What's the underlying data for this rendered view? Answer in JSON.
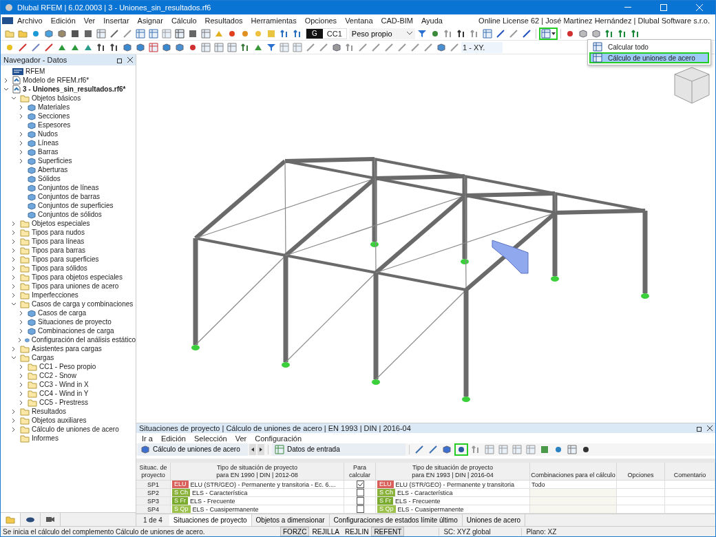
{
  "window": {
    "title": "Dlubal RFEM | 6.02.0003 | 3 - Uniones_sin_resultados.rf6"
  },
  "menu": [
    "Archivo",
    "Edición",
    "Ver",
    "Insertar",
    "Asignar",
    "Cálculo",
    "Resultados",
    "Herramientas",
    "Opciones",
    "Ventana",
    "CAD-BIM",
    "Ayuda"
  ],
  "license": "Online License 62 | José Martinez Hernández | Dlubal Software s.r.o.",
  "toolbar": {
    "load_case_prefix": "G",
    "load_case": "CC1",
    "load_case_name": "Peso propio",
    "view_field": "1 - XY.",
    "calculate_highlighted": true
  },
  "calc_menu": [
    {
      "label": "Calcular todo",
      "selected": false,
      "highlighted": false
    },
    {
      "label": "Cálculo de uniones de acero",
      "selected": true,
      "highlighted": true
    }
  ],
  "navigator": {
    "title": "Navegador - Datos",
    "tree": [
      {
        "label": "RFEM",
        "kind": "root"
      },
      {
        "label": "Modelo de RFEM.rf6*",
        "kind": "model",
        "expanded": false
      },
      {
        "label": "3 - Uniones_sin_resultados.rf6*",
        "kind": "model",
        "bold": true,
        "expanded": true,
        "children": [
          {
            "label": "Objetos básicos",
            "kind": "folder",
            "expanded": true,
            "children": [
              {
                "label": "Materiales",
                "kind": "object",
                "expanded": false
              },
              {
                "label": "Secciones",
                "kind": "object",
                "expanded": false
              },
              {
                "label": "Espesores",
                "kind": "object"
              },
              {
                "label": "Nudos",
                "kind": "object",
                "expanded": false
              },
              {
                "label": "Líneas",
                "kind": "object",
                "expanded": false
              },
              {
                "label": "Barras",
                "kind": "object",
                "expanded": false
              },
              {
                "label": "Superficies",
                "kind": "object",
                "expanded": false
              },
              {
                "label": "Aberturas",
                "kind": "object"
              },
              {
                "label": "Sólidos",
                "kind": "object"
              },
              {
                "label": "Conjuntos de líneas",
                "kind": "object"
              },
              {
                "label": "Conjuntos de barras",
                "kind": "object"
              },
              {
                "label": "Conjuntos de superficies",
                "kind": "object"
              },
              {
                "label": "Conjuntos de sólidos",
                "kind": "object"
              }
            ]
          },
          {
            "label": "Objetos especiales",
            "kind": "folder",
            "expanded": false
          },
          {
            "label": "Tipos para nudos",
            "kind": "folder",
            "expanded": false
          },
          {
            "label": "Tipos para líneas",
            "kind": "folder",
            "expanded": false
          },
          {
            "label": "Tipos para barras",
            "kind": "folder",
            "expanded": false
          },
          {
            "label": "Tipos para superficies",
            "kind": "folder",
            "expanded": false
          },
          {
            "label": "Tipos para sólidos",
            "kind": "folder",
            "expanded": false
          },
          {
            "label": "Tipos para objetos especiales",
            "kind": "folder",
            "expanded": false
          },
          {
            "label": "Tipos para uniones de acero",
            "kind": "folder",
            "expanded": false
          },
          {
            "label": "Imperfecciones",
            "kind": "folder",
            "expanded": false
          },
          {
            "label": "Casos de carga y combinaciones",
            "kind": "folder",
            "expanded": true,
            "children": [
              {
                "label": "Casos de carga",
                "kind": "object",
                "expanded": false
              },
              {
                "label": "Situaciones de proyecto",
                "kind": "object",
                "expanded": false
              },
              {
                "label": "Combinaciones de carga",
                "kind": "object",
                "expanded": false
              },
              {
                "label": "Configuración del análisis estático",
                "kind": "object",
                "expanded": false
              }
            ]
          },
          {
            "label": "Asistentes para cargas",
            "kind": "folder",
            "expanded": false
          },
          {
            "label": "Cargas",
            "kind": "folder",
            "expanded": true,
            "children": [
              {
                "label": "CC1 - Peso propio",
                "kind": "folder",
                "expanded": false
              },
              {
                "label": "CC2 - Snow",
                "kind": "folder",
                "expanded": false
              },
              {
                "label": "CC3 - Wind in X",
                "kind": "folder",
                "expanded": false
              },
              {
                "label": "CC4 - Wind in Y",
                "kind": "folder",
                "expanded": false
              },
              {
                "label": "CC5 - Prestress",
                "kind": "folder",
                "expanded": false
              }
            ]
          },
          {
            "label": "Resultados",
            "kind": "folder",
            "expanded": false
          },
          {
            "label": "Objetos auxiliares",
            "kind": "folder",
            "expanded": false
          },
          {
            "label": "Cálculo de uniones de acero",
            "kind": "folder",
            "expanded": false
          },
          {
            "label": "Informes",
            "kind": "folder"
          }
        ]
      }
    ],
    "tabs": [
      {
        "selected": true
      },
      {
        "selected": false
      },
      {
        "selected": false
      }
    ]
  },
  "panel": {
    "title": "Situaciones de proyecto | Cálculo de uniones de acero | EN 1993 | DIN | 2016-04",
    "menu": [
      "Ir a",
      "Edición",
      "Selección",
      "Ver",
      "Configuración"
    ],
    "module": "Cálculo de uniones de acero",
    "view": "Datos de entrada",
    "calculate_highlighted": true,
    "columns": [
      "Situac. de\nproyecto",
      "Tipo de situación de proyecto\npara EN 1990 | DIN | 2012-08",
      "Para\ncalcular",
      "Tipo de situación de proyecto\npara EN 1993 | DIN | 2016-04",
      "Combinaciones para el cálculo",
      "Opciones",
      "Comentario"
    ],
    "rows": [
      {
        "id": "SP1",
        "tag": "ELU",
        "color": "#d9605a",
        "type": "ELU (STR/GEO) - Permanente y transitoria - Ec. 6....",
        "checked": true,
        "tag2": "ELU",
        "type2": "ELU (STR/GEO) - Permanente y transitoria",
        "combos": "Todo"
      },
      {
        "id": "SP2",
        "tag": "S Ch",
        "color": "#8bb33c",
        "type": "ELS - Característica",
        "checked": false,
        "tag2": "S Ch",
        "type2": "ELS - Característica"
      },
      {
        "id": "SP3",
        "tag": "S Fr",
        "color": "#7aab2c",
        "type": "ELS - Frecuente",
        "checked": false,
        "tag2": "S Fr",
        "type2": "ELS - Frecuente"
      },
      {
        "id": "SP4",
        "tag": "S Qp",
        "color": "#9cc24c",
        "type": "ELS - Cuasipermanente",
        "checked": false,
        "tag2": "S Qp",
        "type2": "ELS - Cuasipermanente"
      }
    ],
    "pager": "1 de 4",
    "tabs": [
      {
        "label": "Situaciones de proyecto",
        "selected": true
      },
      {
        "label": "Objetos a dimensionar",
        "selected": false
      },
      {
        "label": "Configuraciones de estados límite último",
        "selected": false
      },
      {
        "label": "Uniones de acero",
        "selected": false
      }
    ]
  },
  "status": {
    "message": "Se inicia el cálculo del complemento Cálculo de uniones de acero.",
    "toggles": [
      {
        "label": "FORZC",
        "on": true
      },
      {
        "label": "REJILLA",
        "on": false
      },
      {
        "label": "REJLIN",
        "on": false
      },
      {
        "label": "REFENT",
        "on": true
      }
    ],
    "cs": "SC: XYZ global",
    "plane": "Plano: XZ"
  }
}
